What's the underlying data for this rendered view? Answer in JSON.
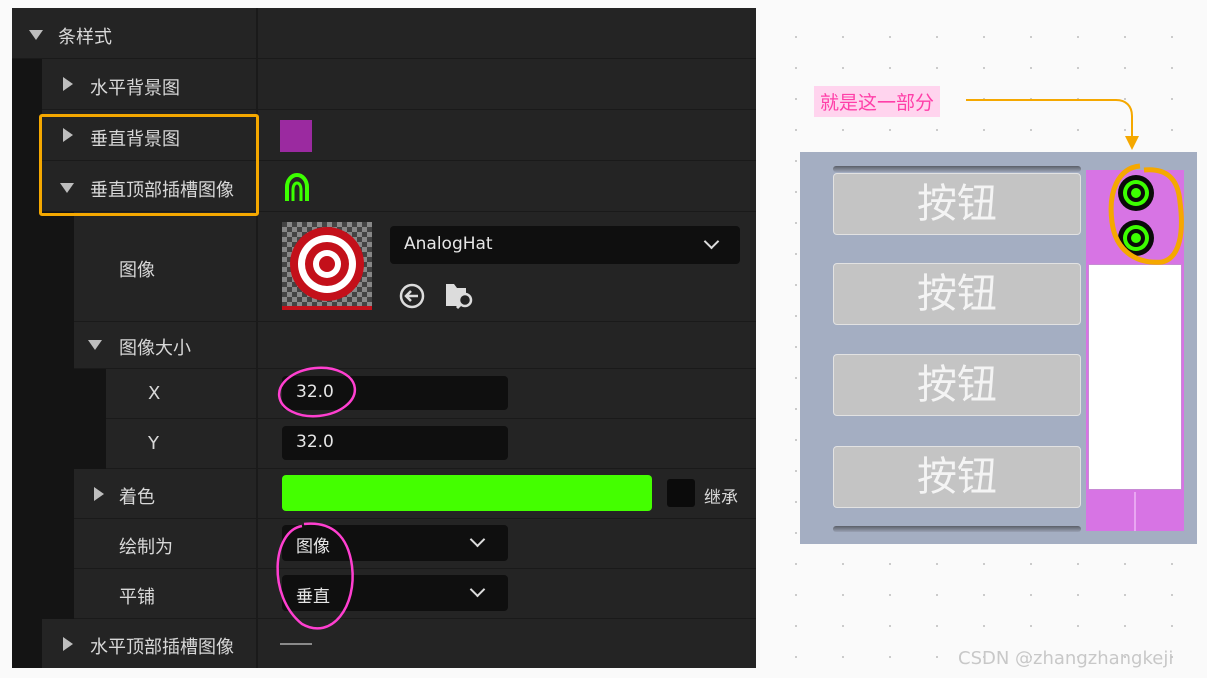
{
  "editor": {
    "rows": {
      "bar_style": "条样式",
      "horizontal_bg": "水平背景图",
      "vertical_bg": "垂直背景图",
      "vertical_top_slot": "垂直顶部插槽图像",
      "image": "图像",
      "image_size": "图像大小",
      "x": "X",
      "y": "Y",
      "tint": "着色",
      "draw_as": "绘制为",
      "tiling": "平铺",
      "horizontal_top_slot": "水平顶部插槽图像"
    },
    "image_asset": "AnalogHat",
    "size_x": "32.0",
    "size_y": "32.0",
    "tint_inherit": "继承",
    "draw_as_value": "图像",
    "tiling_value": "垂直",
    "colors": {
      "vertical_bg": "#9b2aa0",
      "tint": "#44ff00",
      "highlight": "#f5a800",
      "annotation": "#ff3fd0"
    }
  },
  "annotation": {
    "label": "就是这一部分",
    "color": "#ff3fa8"
  },
  "preview": {
    "buttons": [
      "按钮",
      "按钮",
      "按钮",
      "按钮"
    ],
    "scrollbar_color": "#d774e4"
  },
  "watermark": "CSDN @zhangzhangkeji"
}
